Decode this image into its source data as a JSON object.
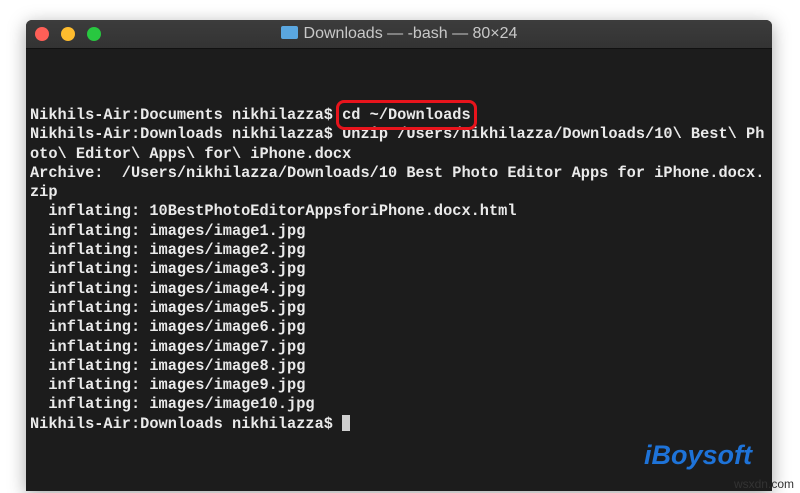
{
  "window": {
    "title": "Downloads — -bash — 80×24",
    "traffic_lights": {
      "close": "#fe5f57",
      "minimize": "#febc2e",
      "zoom": "#28c840"
    }
  },
  "terminal": {
    "lines": [
      "Nikhils-Air:Documents nikhilazza$ ",
      "Nikhils-Air:Downloads nikhilazza$ Unzip /Users/nikhilazza/Downloads/10\\ Best\\ Ph",
      "oto\\ Editor\\ Apps\\ for\\ iPhone.docx",
      "Archive:  /Users/nikhilazza/Downloads/10 Best Photo Editor Apps for iPhone.docx.",
      "zip",
      "  inflating: 10BestPhotoEditorAppsforiPhone.docx.html",
      "  inflating: images/image1.jpg",
      "  inflating: images/image2.jpg",
      "  inflating: images/image3.jpg",
      "  inflating: images/image4.jpg",
      "  inflating: images/image5.jpg",
      "  inflating: images/image6.jpg",
      "  inflating: images/image7.jpg",
      "  inflating: images/image8.jpg",
      "  inflating: images/image9.jpg",
      "  inflating: images/image10.jpg",
      "Nikhils-Air:Downloads nikhilazza$ "
    ],
    "highlighted_command": "cd ~/Downloads",
    "highlight_color": "#e8141c"
  },
  "branding": {
    "logo": "iBoysoft",
    "watermark": "wsxdn.com"
  }
}
